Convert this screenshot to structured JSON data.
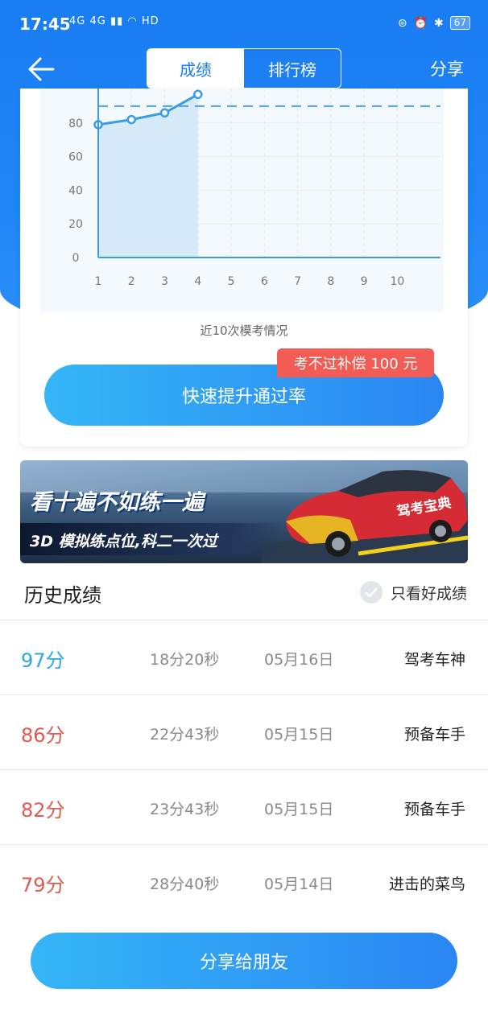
{
  "status_bar": {
    "time": "17:45",
    "network": "4G 4G",
    "hd": "HD",
    "battery": "67"
  },
  "nav": {
    "tabs": [
      {
        "label": "成绩"
      },
      {
        "label": "排行榜"
      }
    ],
    "share_label": "分享"
  },
  "chart_data": {
    "type": "line",
    "x": [
      1,
      2,
      3,
      4,
      5,
      6,
      7,
      8,
      9,
      10
    ],
    "x_tick_labels": [
      "1",
      "2",
      "3",
      "4",
      "5",
      "6",
      "7",
      "8",
      "9",
      "10"
    ],
    "series": [
      {
        "values": [
          79,
          82,
          86,
          97
        ]
      }
    ],
    "reference_line": 90,
    "ylim": [
      0,
      100
    ],
    "y_ticks": [
      "0",
      "20",
      "40",
      "60",
      "80"
    ],
    "grid": true,
    "caption": "近10次模考情况",
    "colors": {
      "line": "#3a9be6",
      "area": "#cfe6f8",
      "reference": "#4aa3e0"
    }
  },
  "promo": {
    "badge": "考不过补偿 100 元",
    "button": "快速提升通过率"
  },
  "banner": {
    "title": "看十遍不如练一遍",
    "subtitle": "3D 模拟练点位,科二一次过",
    "car_label": "驾考宝典"
  },
  "history": {
    "title": "历史成绩",
    "filter_label": "只看好成绩",
    "rows": [
      {
        "score": "97分",
        "duration": "18分20秒",
        "date": "05月16日",
        "title": "驾考车神",
        "color": "#2aa7e8"
      },
      {
        "score": "86分",
        "duration": "22分43秒",
        "date": "05月15日",
        "title": "预备车手",
        "color": "#e05a4e"
      },
      {
        "score": "82分",
        "duration": "23分43秒",
        "date": "05月15日",
        "title": "预备车手",
        "color": "#e05a4e"
      },
      {
        "score": "79分",
        "duration": "28分40秒",
        "date": "05月14日",
        "title": "进击的菜鸟",
        "color": "#e05a4e"
      }
    ]
  },
  "footer": {
    "share_button": "分享给朋友"
  },
  "colors": {
    "primary": "#1a7df3",
    "button_gradient_start": "#35b6f7",
    "button_gradient_end": "#2a86f3",
    "badge": "#f25c54"
  }
}
